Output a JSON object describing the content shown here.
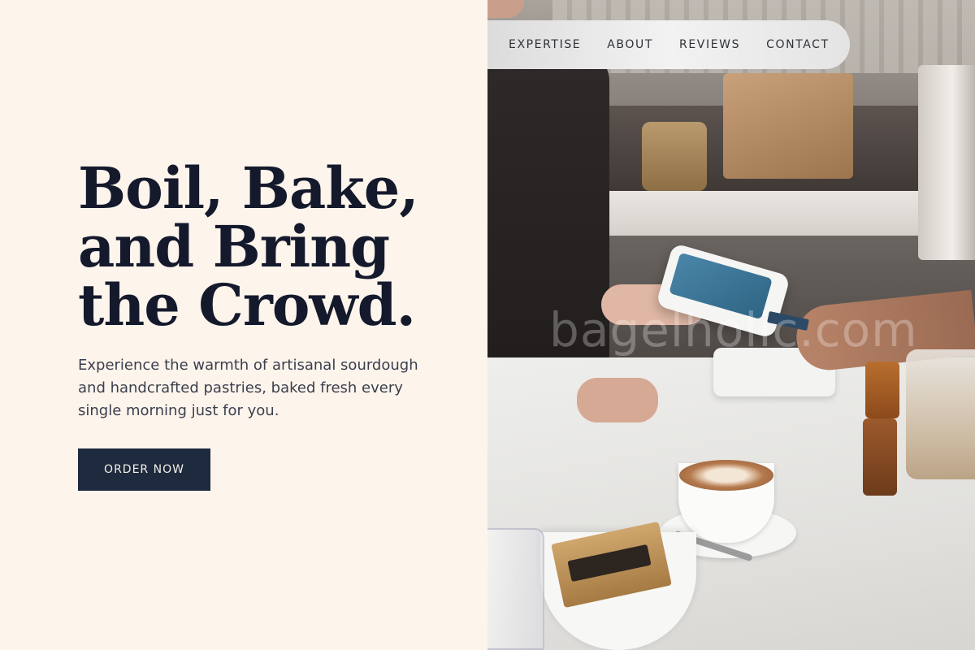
{
  "nav": {
    "links": [
      {
        "label": "EXPERTISE"
      },
      {
        "label": "ABOUT"
      },
      {
        "label": "REVIEWS"
      },
      {
        "label": "CONTACT"
      }
    ]
  },
  "hero": {
    "headline_line1": "Boil, Bake,",
    "headline_line2": "and Bring",
    "headline_line3": "the Crowd.",
    "subtext": "Experience the warmth of artisanal sourdough and handcrafted pastries, baked fresh every single morning just for you.",
    "cta_label": "ORDER NOW"
  },
  "photo": {
    "watermark": "bagelholic.com"
  },
  "colors": {
    "background": "#fdf4ec",
    "headline": "#141a2c",
    "button": "#1e2a3d",
    "button_text": "#f4efe9"
  }
}
